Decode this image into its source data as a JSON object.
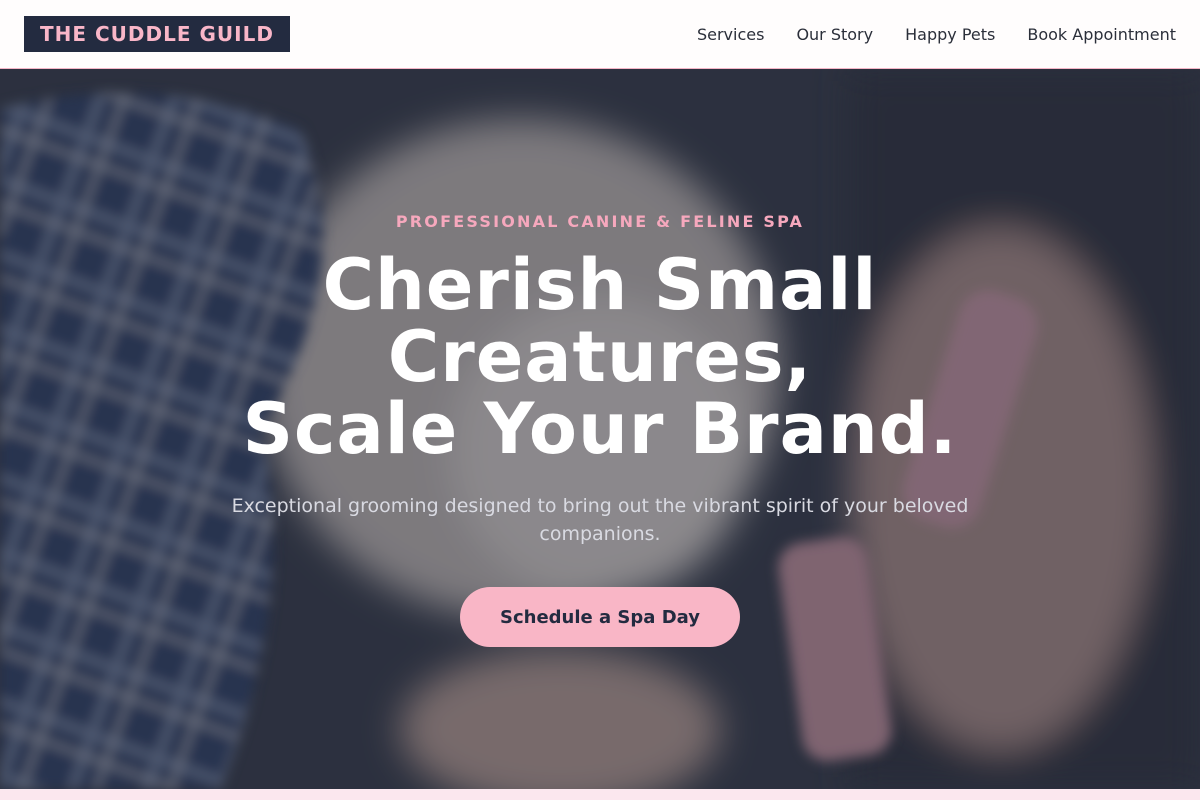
{
  "brand": {
    "logo_text": "THE CUDDLE GUILD"
  },
  "nav": {
    "items": [
      {
        "label": "Services"
      },
      {
        "label": "Our Story"
      },
      {
        "label": "Happy Pets"
      },
      {
        "label": "Book Appointment"
      }
    ]
  },
  "hero": {
    "eyebrow": "PROFESSIONAL CANINE & FELINE SPA",
    "headline_line1": "Cherish Small",
    "headline_line2": "Creatures,",
    "headline_line3": "Scale Your Brand.",
    "subtext": "Exceptional grooming designed to bring out the vibrant spirit of your beloved companions.",
    "cta_label": "Schedule a Spa Day"
  },
  "colors": {
    "accent_pink": "#f9b6c6",
    "navy": "#232b40"
  }
}
